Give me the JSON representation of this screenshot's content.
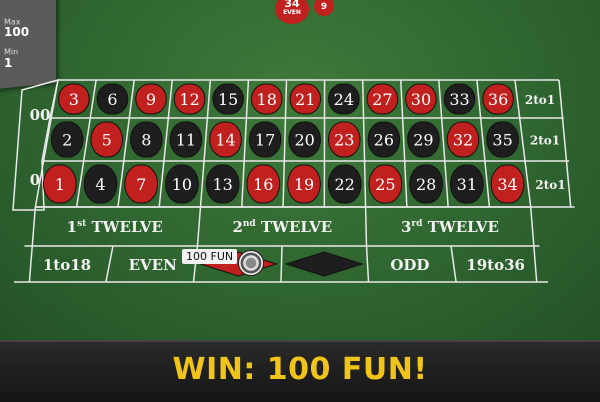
{
  "limits": {
    "max_label": "Max",
    "max_value": "100",
    "min_label": "Min",
    "min_value": "1"
  },
  "history": [
    {
      "number": "34",
      "note": "EVEN",
      "color": "#c0201e"
    },
    {
      "number": "9",
      "note": "",
      "color": "#c0201e"
    }
  ],
  "grid": {
    "rows": [
      [
        "3",
        "6",
        "9",
        "12",
        "15",
        "18",
        "21",
        "24",
        "27",
        "30",
        "33",
        "36"
      ],
      [
        "2",
        "5",
        "8",
        "11",
        "14",
        "17",
        "20",
        "23",
        "26",
        "29",
        "32",
        "35"
      ],
      [
        "1",
        "4",
        "7",
        "10",
        "13",
        "16",
        "19",
        "22",
        "25",
        "28",
        "31",
        "34"
      ]
    ],
    "red_numbers": [
      "1",
      "3",
      "5",
      "7",
      "9",
      "12",
      "14",
      "16",
      "18",
      "19",
      "21",
      "23",
      "25",
      "27",
      "30",
      "32",
      "34",
      "36"
    ],
    "zeros": [
      "00",
      "0"
    ],
    "columns": [
      "2to1",
      "2to1",
      "2to1"
    ]
  },
  "dozens": [
    {
      "main": "1",
      "sup": "st",
      "rest": " TWELVE"
    },
    {
      "main": "2",
      "sup": "nd",
      "rest": " TWELVE"
    },
    {
      "main": "3",
      "sup": "rd",
      "rest": " TWELVE"
    }
  ],
  "outside": [
    "1to18",
    "EVEN",
    "RED",
    "BLACK",
    "ODD",
    "19to36"
  ],
  "bet": {
    "label": "100 FUN"
  },
  "win_text": "WIN: 100 FUN!",
  "colors": {
    "red": "#c0201e",
    "black": "#1e1e1e",
    "felt": "#2f6530",
    "win": "#f0c419"
  }
}
